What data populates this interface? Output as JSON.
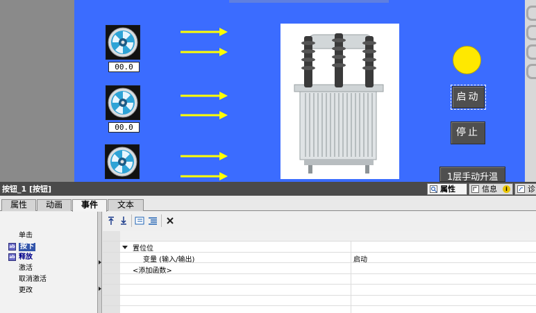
{
  "hmi": {
    "fans": [
      {
        "value": "00.0"
      },
      {
        "value": "00.0"
      },
      {
        "value": ""
      }
    ],
    "buttons": {
      "start": "启动",
      "stop": "停止",
      "manual": "1层手动升温"
    },
    "colors": {
      "screen": "#3b6cff",
      "arrow": "#ffff00",
      "lamp": "#ffe800",
      "button": "#4f4f4f"
    }
  },
  "inspector": {
    "title": "按钮_1 [按钮]",
    "right_tabs": {
      "properties": "属性",
      "info": "信息",
      "diagnostics": "诊"
    },
    "tabs": {
      "properties": "属性",
      "animation": "动画",
      "events": "事件",
      "text": "文本"
    },
    "events": {
      "click": "单击",
      "press": "按下",
      "release": "释放",
      "activate": "激活",
      "deactivate": "取消激活",
      "change": "更改"
    },
    "function_list": {
      "function": "置位位",
      "param_name": "变量 (输入/输出)",
      "param_value": "启动",
      "add": "<添加函数>"
    },
    "toolbar_icons": [
      "move-up-icon",
      "move-down-icon",
      "expand-all-icon",
      "collapse-all-icon",
      "delete-icon"
    ]
  }
}
